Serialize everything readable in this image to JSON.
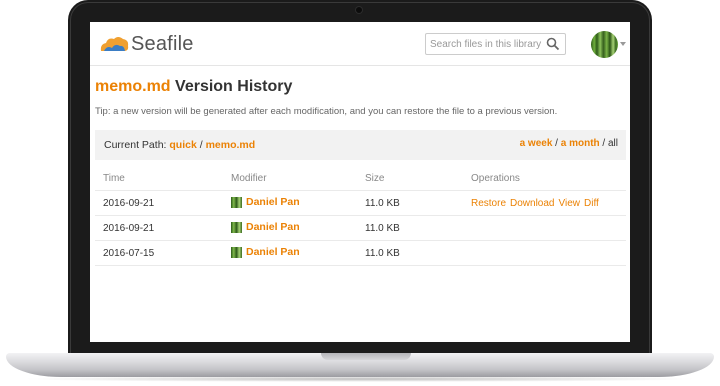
{
  "app": {
    "logo_text": "Seafile"
  },
  "search": {
    "placeholder": "Search files in this library"
  },
  "page": {
    "file_name": "memo.md",
    "title_suffix": " Version History"
  },
  "tip": "Tip: a new version will be generated after each modification, and you can restore the file to a previous version.",
  "path": {
    "label": "Current Path: ",
    "segments": [
      "quick",
      "memo.md"
    ],
    "separator": " / "
  },
  "filters": {
    "week": "a week",
    "month": "a month",
    "all": "all",
    "separator": " / "
  },
  "table": {
    "columns": [
      "Time",
      "Modifier",
      "Size",
      "Operations"
    ],
    "rows": [
      {
        "time": "2016-09-21",
        "modifier": "Daniel Pan",
        "size": "11.0 KB",
        "operations": [
          "Restore",
          "Download",
          "View",
          "Diff"
        ]
      },
      {
        "time": "2016-09-21",
        "modifier": "Daniel Pan",
        "size": "11.0 KB",
        "operations": []
      },
      {
        "time": "2016-07-15",
        "modifier": "Daniel Pan",
        "size": "11.0 KB",
        "operations": []
      }
    ]
  },
  "colors": {
    "accent": "#eb8205",
    "logo_blue": "#3b7dc4",
    "logo_orange": "#f0a031"
  }
}
